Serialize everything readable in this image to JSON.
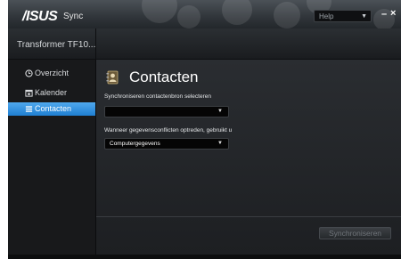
{
  "titlebar": {
    "brand": "/ISUS",
    "app_name": "Sync",
    "help_label": "Help",
    "minimize": "–",
    "close": "×"
  },
  "device": {
    "name": "Transformer TF10..."
  },
  "sidebar": {
    "items": [
      {
        "label": "Overzicht",
        "icon": "clock-icon"
      },
      {
        "label": "Kalender",
        "icon": "calendar-icon"
      },
      {
        "label": "Contacten",
        "icon": "list-icon",
        "active": true
      }
    ]
  },
  "main": {
    "title": "Contacten",
    "source_label": "Synchroniseren contactenbron selecteren",
    "source_value": "",
    "conflict_label": "Wanneer gegevensconflicten optreden, gebruikt u",
    "conflict_value": "Computergegevens",
    "sync_button": "Synchroniseren"
  },
  "colors": {
    "accent": "#2c8ddc",
    "background": "#1c1d1f"
  }
}
